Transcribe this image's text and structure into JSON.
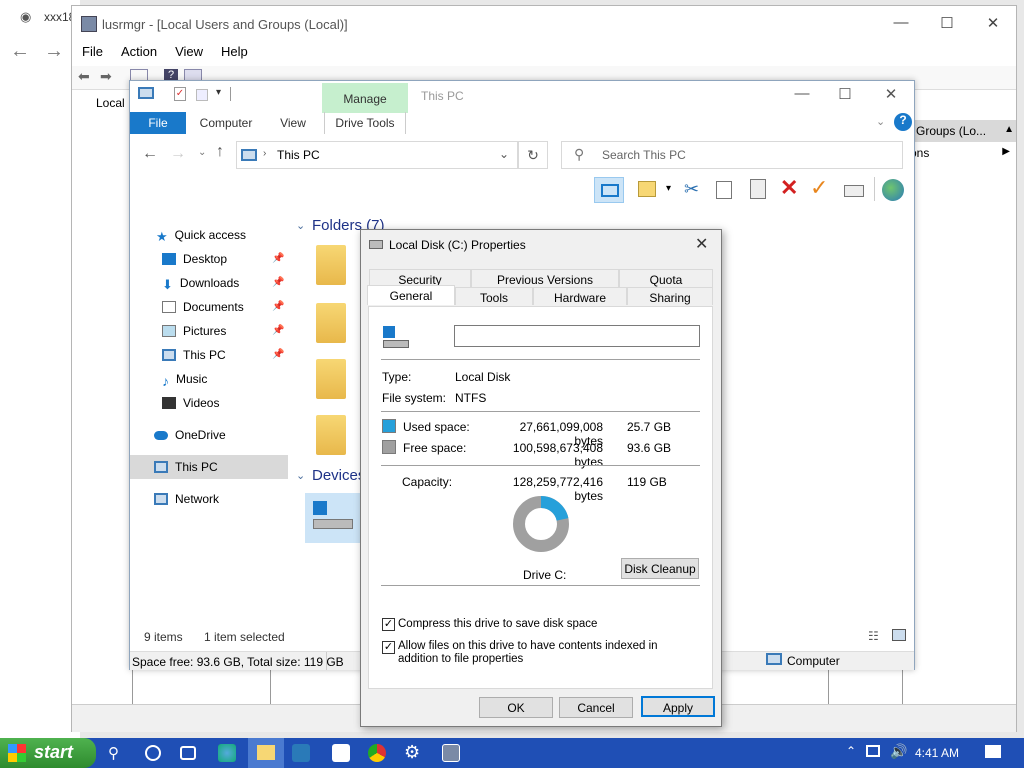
{
  "browser": {
    "tab_text": "xxx18",
    "back": "←",
    "forward": "→"
  },
  "lusrmgr": {
    "title": "lusrmgr - [Local Users and Groups (Local)]",
    "menu": [
      "File",
      "Action",
      "View",
      "Help"
    ],
    "tree_item": "Local",
    "actions_header": "d Groups (Lo...",
    "actions_sub": "ons",
    "status_right": "Computer"
  },
  "explorer": {
    "title": "This PC",
    "manage": "Manage",
    "tabs": [
      "File",
      "Computer",
      "View",
      "Drive Tools"
    ],
    "address": "This PC",
    "search_placeholder": "Search This PC",
    "nav": [
      {
        "label": "Quick access"
      },
      {
        "label": "Desktop",
        "pinned": true
      },
      {
        "label": "Downloads",
        "pinned": true
      },
      {
        "label": "Documents",
        "pinned": true
      },
      {
        "label": "Pictures",
        "pinned": true
      },
      {
        "label": "This PC",
        "pinned": true
      },
      {
        "label": "Music"
      },
      {
        "label": "Videos"
      },
      {
        "label": "OneDrive"
      },
      {
        "label": "This PC"
      },
      {
        "label": "Network"
      }
    ],
    "folders_header": "Folders (7)",
    "devices_header": "Devices",
    "items_count": "9 items",
    "selected": "1 item selected",
    "space_status": "Space free: 93.6 GB, Total size: 119 GB"
  },
  "dialog": {
    "title": "Local Disk (C:) Properties",
    "tabs_top": [
      "Security",
      "Previous Versions",
      "Quota"
    ],
    "tabs_bottom": [
      "General",
      "Tools",
      "Hardware",
      "Sharing"
    ],
    "name_value": "",
    "type_label": "Type:",
    "type_value": "Local Disk",
    "fs_label": "File system:",
    "fs_value": "NTFS",
    "used_label": "Used space:",
    "used_bytes": "27,661,099,008 bytes",
    "used_gb": "25.7 GB",
    "free_label": "Free space:",
    "free_bytes": "100,598,673,408 bytes",
    "free_gb": "93.6 GB",
    "capacity_label": "Capacity:",
    "capacity_bytes": "128,259,772,416 bytes",
    "capacity_gb": "119 GB",
    "drive_label": "Drive C:",
    "disk_cleanup": "Disk Cleanup",
    "compress_label": "Compress this drive to save disk space",
    "index_label": "Allow files on this drive to have contents indexed in addition to file properties",
    "used_fraction": 0.2157,
    "colors": {
      "used": "#26a0da",
      "free": "#a0a0a0"
    },
    "ok": "OK",
    "cancel": "Cancel",
    "apply": "Apply"
  },
  "taskbar": {
    "start": "start",
    "time": "4:41 AM"
  }
}
